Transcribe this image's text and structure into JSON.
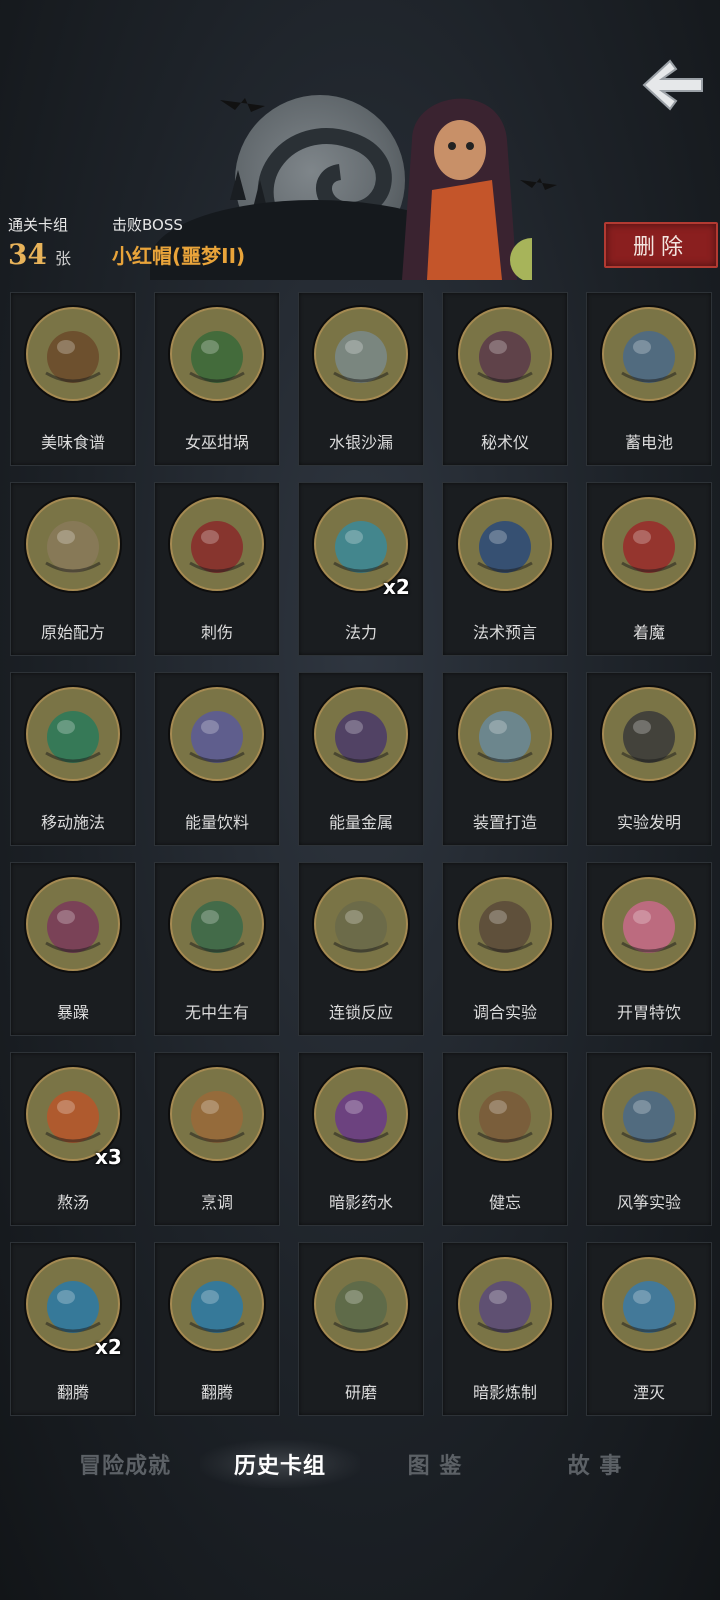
{
  "header": {
    "deck_count_label": "通关卡组",
    "deck_count": "34",
    "deck_count_unit": "张",
    "boss_label": "击败BOSS",
    "boss_name": "小红帽(噩梦II)",
    "delete_label": "删除",
    "back_icon": "back-arrow-icon"
  },
  "cards": [
    {
      "name": "美味食谱",
      "badge": "",
      "icon": "recipe-book-icon",
      "theme": "#6b4a2a"
    },
    {
      "name": "女巫坩埚",
      "badge": "",
      "icon": "cauldron-icon",
      "theme": "#3a6a3a"
    },
    {
      "name": "水银沙漏",
      "badge": "",
      "icon": "hourglass-icon",
      "theme": "#7a8a8a"
    },
    {
      "name": "秘术仪",
      "badge": "",
      "icon": "arcane-device-icon",
      "theme": "#5a3a4a"
    },
    {
      "name": "蓄电池",
      "badge": "",
      "icon": "battery-icon",
      "theme": "#4a6a8a"
    },
    {
      "name": "原始配方",
      "badge": "",
      "icon": "scroll-icon",
      "theme": "#8a7a5a"
    },
    {
      "name": "刺伤",
      "badge": "",
      "icon": "dagger-icon",
      "theme": "#8a2a2a"
    },
    {
      "name": "法力",
      "badge": "x2",
      "icon": "mana-orb-icon",
      "theme": "#3a8a9a"
    },
    {
      "name": "法术预言",
      "badge": "",
      "icon": "crystal-ball-icon",
      "theme": "#2a4a7a"
    },
    {
      "name": "着魔",
      "badge": "",
      "icon": "possessed-icon",
      "theme": "#9a2a2a"
    },
    {
      "name": "移动施法",
      "badge": "",
      "icon": "wizard-icon",
      "theme": "#2a7a5a"
    },
    {
      "name": "能量饮料",
      "badge": "",
      "icon": "energy-drink-icon",
      "theme": "#5a5a9a"
    },
    {
      "name": "能量金属",
      "badge": "",
      "icon": "energy-metal-icon",
      "theme": "#4a3a6a"
    },
    {
      "name": "装置打造",
      "badge": "",
      "icon": "device-craft-icon",
      "theme": "#6a8a9a"
    },
    {
      "name": "实验发明",
      "badge": "",
      "icon": "invention-icon",
      "theme": "#3a3a3a"
    },
    {
      "name": "暴躁",
      "badge": "",
      "icon": "rage-monster-icon",
      "theme": "#7a3a5a"
    },
    {
      "name": "无中生有",
      "badge": "",
      "icon": "creation-icon",
      "theme": "#3a6a4a"
    },
    {
      "name": "连锁反应",
      "badge": "",
      "icon": "dominoes-icon",
      "theme": "#6a6a4a"
    },
    {
      "name": "调合实验",
      "badge": "",
      "icon": "mixing-icon",
      "theme": "#5a4a3a"
    },
    {
      "name": "开胃特饮",
      "badge": "",
      "icon": "cocktail-icon",
      "theme": "#c86a8a"
    },
    {
      "name": "熬汤",
      "badge": "x3",
      "icon": "soup-pot-icon",
      "theme": "#b8562a"
    },
    {
      "name": "烹调",
      "badge": "",
      "icon": "cooking-fox-icon",
      "theme": "#9a6a3a"
    },
    {
      "name": "暗影药水",
      "badge": "",
      "icon": "shadow-potion-icon",
      "theme": "#6a3a8a"
    },
    {
      "name": "健忘",
      "badge": "",
      "icon": "forgetful-icon",
      "theme": "#7a5a3a"
    },
    {
      "name": "风筝实验",
      "badge": "",
      "icon": "kite-icon",
      "theme": "#4a6a8a"
    },
    {
      "name": "翻腾",
      "badge": "x2",
      "icon": "blue-flame-icon",
      "theme": "#2a7aa8"
    },
    {
      "name": "翻腾",
      "badge": "",
      "icon": "blue-flame-icon",
      "theme": "#2a7aa8"
    },
    {
      "name": "研磨",
      "badge": "",
      "icon": "grinding-icon",
      "theme": "#5a6a4a"
    },
    {
      "name": "暗影炼制",
      "badge": "",
      "icon": "shadow-forge-icon",
      "theme": "#5a4a7a"
    },
    {
      "name": "湮灭",
      "badge": "",
      "icon": "annihilation-icon",
      "theme": "#3a7aa8"
    }
  ],
  "tabs": [
    {
      "label": "冒险成就",
      "active": false
    },
    {
      "label": "历史卡组",
      "active": true
    },
    {
      "label": "图 鉴",
      "active": false
    },
    {
      "label": "故 事",
      "active": false
    }
  ]
}
